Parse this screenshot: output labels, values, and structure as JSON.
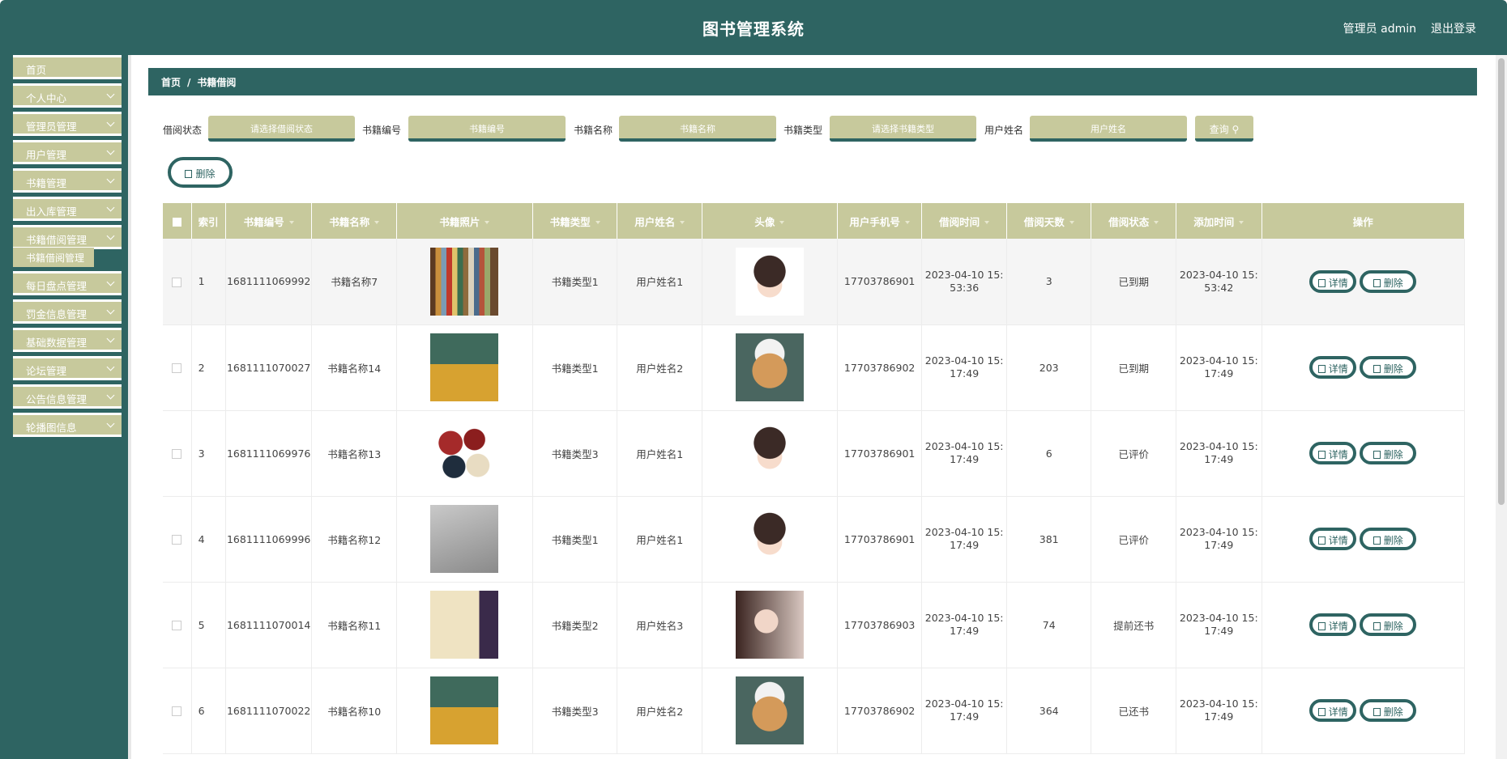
{
  "header": {
    "title": "图书管理系统",
    "user": "管理员 admin",
    "logout": "退出登录"
  },
  "sidebar": {
    "items": [
      {
        "label": "首页",
        "chevron": false
      },
      {
        "label": "个人中心",
        "chevron": true
      },
      {
        "label": "管理员管理",
        "chevron": true
      },
      {
        "label": "用户管理",
        "chevron": true
      },
      {
        "label": "书籍管理",
        "chevron": true
      },
      {
        "label": "出入库管理",
        "chevron": true
      },
      {
        "label": "书籍借阅管理",
        "chevron": true
      },
      {
        "label": "每日盘点管理",
        "chevron": true
      },
      {
        "label": "罚金信息管理",
        "chevron": true
      },
      {
        "label": "基础数据管理",
        "chevron": true
      },
      {
        "label": "论坛管理",
        "chevron": true
      },
      {
        "label": "公告信息管理",
        "chevron": true
      },
      {
        "label": "轮播图信息",
        "chevron": true
      }
    ],
    "active_sub": "书籍借阅管理"
  },
  "breadcrumb": {
    "home": "首页",
    "sep": "/",
    "current": "书籍借阅"
  },
  "filters": [
    {
      "label": "借阅状态",
      "placeholder": "请选择借阅状态"
    },
    {
      "label": "书籍编号",
      "placeholder": "书籍编号"
    },
    {
      "label": "书籍名称",
      "placeholder": "书籍名称"
    },
    {
      "label": "书籍类型",
      "placeholder": "请选择书籍类型"
    },
    {
      "label": "用户姓名",
      "placeholder": "用户姓名"
    }
  ],
  "query_label": "查询",
  "delete_label": "删除",
  "table": {
    "headers": [
      "索引",
      "书籍编号",
      "书籍名称",
      "书籍照片",
      "书籍类型",
      "用户姓名",
      "头像",
      "用户手机号",
      "借阅时间",
      "借阅天数",
      "借阅状态",
      "添加时间",
      "操作"
    ],
    "detail_label": "详情",
    "delete_label": "删除",
    "rows": [
      {
        "index": "1",
        "code": "1681111069992",
        "name": "书籍名称7",
        "photo": "book-shelf",
        "type": "书籍类型1",
        "user": "用户姓名1",
        "avatar": "avatar-girl",
        "phone": "17703786901",
        "borrow_time_1": "2023-04-10 15:",
        "borrow_time_2": "53:36",
        "days": "3",
        "status": "已到期",
        "add_time_1": "2023-04-10 15:",
        "add_time_2": "53:42"
      },
      {
        "index": "2",
        "code": "1681111070027",
        "name": "书籍名称14",
        "photo": "book-cover",
        "type": "书籍类型1",
        "user": "用户姓名2",
        "avatar": "avatar-cat",
        "phone": "17703786902",
        "borrow_time_1": "2023-04-10 15:",
        "borrow_time_2": "17:49",
        "days": "203",
        "status": "已到期",
        "add_time_1": "2023-04-10 15:",
        "add_time_2": "17:49"
      },
      {
        "index": "3",
        "code": "1681111069976",
        "name": "书籍名称13",
        "photo": "book-stack",
        "type": "书籍类型3",
        "user": "用户姓名1",
        "avatar": "avatar-girl",
        "phone": "17703786901",
        "borrow_time_1": "2023-04-10 15:",
        "borrow_time_2": "17:49",
        "days": "6",
        "status": "已评价",
        "add_time_1": "2023-04-10 15:",
        "add_time_2": "17:49"
      },
      {
        "index": "4",
        "code": "1681111069996",
        "name": "书籍名称12",
        "photo": "book-grey",
        "type": "书籍类型1",
        "user": "用户姓名1",
        "avatar": "avatar-girl",
        "phone": "17703786901",
        "borrow_time_1": "2023-04-10 15:",
        "borrow_time_2": "17:49",
        "days": "381",
        "status": "已评价",
        "add_time_1": "2023-04-10 15:",
        "add_time_2": "17:49"
      },
      {
        "index": "5",
        "code": "1681111070014",
        "name": "书籍名称11",
        "photo": "book-sanguo",
        "type": "书籍类型2",
        "user": "用户姓名3",
        "avatar": "avatar-woman",
        "phone": "17703786903",
        "borrow_time_1": "2023-04-10 15:",
        "borrow_time_2": "17:49",
        "days": "74",
        "status": "提前还书",
        "add_time_1": "2023-04-10 15:",
        "add_time_2": "17:49"
      },
      {
        "index": "6",
        "code": "1681111070022",
        "name": "书籍名称10",
        "photo": "book-cover",
        "type": "书籍类型3",
        "user": "用户姓名2",
        "avatar": "avatar-cat",
        "phone": "17703786902",
        "borrow_time_1": "2023-04-10 15:",
        "borrow_time_2": "17:49",
        "days": "364",
        "status": "已还书",
        "add_time_1": "2023-04-10 15:",
        "add_time_2": "17:49"
      }
    ]
  }
}
